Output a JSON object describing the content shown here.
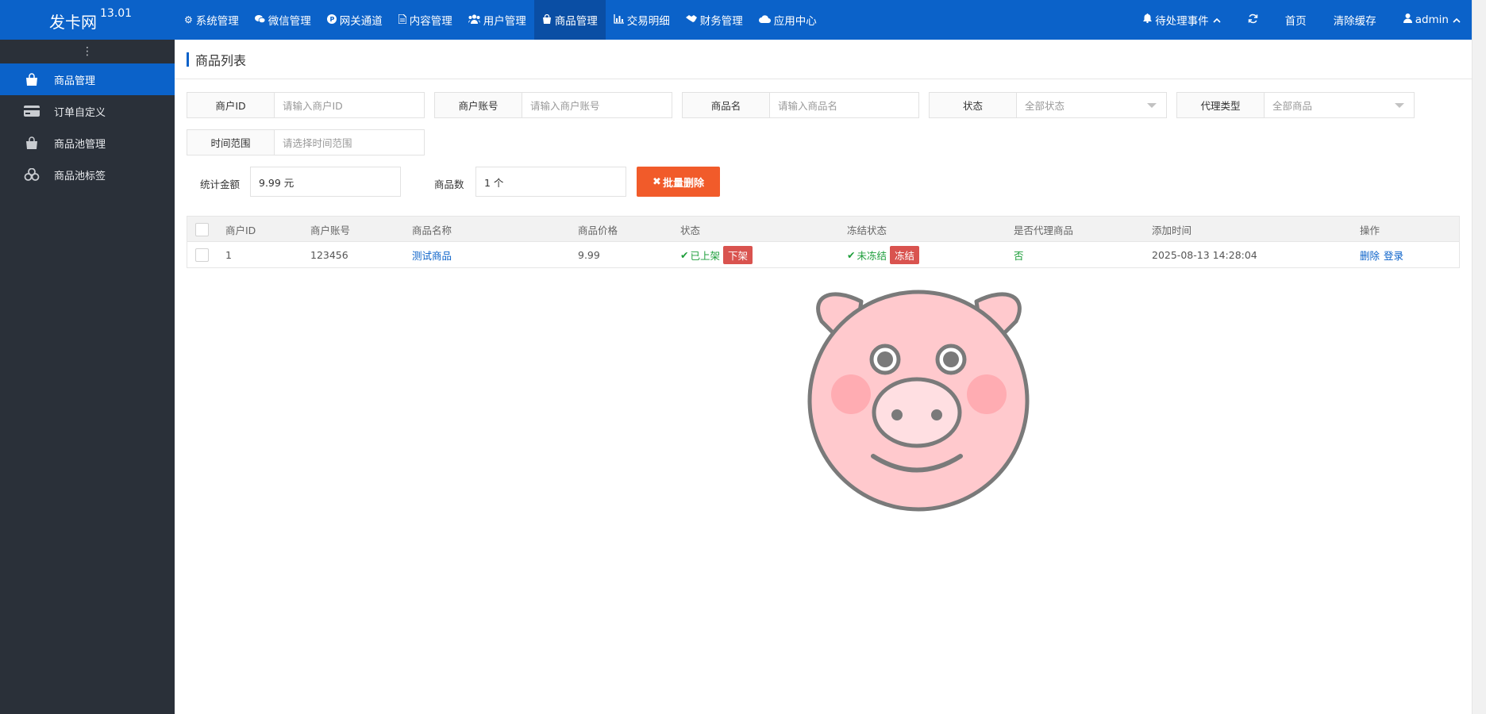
{
  "app": {
    "title": "发卡网",
    "version": "13.01"
  },
  "topnav": [
    {
      "label": "系统管理",
      "icon": "gear-icon"
    },
    {
      "label": "微信管理",
      "icon": "wechat-icon"
    },
    {
      "label": "网关通道",
      "icon": "paypal-icon"
    },
    {
      "label": "内容管理",
      "icon": "file-icon"
    },
    {
      "label": "用户管理",
      "icon": "users-icon"
    },
    {
      "label": "商品管理",
      "icon": "shopping-bag-icon",
      "active": true
    },
    {
      "label": "交易明细",
      "icon": "bar-chart-icon"
    },
    {
      "label": "财务管理",
      "icon": "handshake-icon"
    },
    {
      "label": "应用中心",
      "icon": "cloud-icon"
    }
  ],
  "topright": {
    "pending": "待处理事件",
    "home": "首页",
    "clear_cache": "清除缓存",
    "user": "admin"
  },
  "sidebar": {
    "items": [
      {
        "label": "商品管理",
        "icon": "shopping-bag-icon",
        "active": true
      },
      {
        "label": "订单自定义",
        "icon": "credit-card-icon"
      },
      {
        "label": "商品池管理",
        "icon": "shopping-bag-icon"
      },
      {
        "label": "商品池标签",
        "icon": "cubes-icon"
      }
    ]
  },
  "page": {
    "title": "商品列表"
  },
  "filters": {
    "merchant_id": {
      "label": "商户ID",
      "placeholder": "请输入商户ID"
    },
    "merchant_account": {
      "label": "商户账号",
      "placeholder": "请输入商户账号"
    },
    "product_name": {
      "label": "商品名",
      "placeholder": "请输入商品名"
    },
    "status": {
      "label": "状态",
      "value": "全部状态"
    },
    "agent_type": {
      "label": "代理类型",
      "value": "全部商品"
    },
    "time_range": {
      "label": "时间范围",
      "placeholder": "请选择时间范围"
    }
  },
  "stats": {
    "amount_label": "统计金额",
    "amount_value": "9.99 元",
    "count_label": "商品数",
    "count_value": "1 个",
    "batch_delete": "批量删除"
  },
  "table": {
    "headers": [
      "商户ID",
      "商户账号",
      "商品名称",
      "商品价格",
      "状态",
      "冻结状态",
      "是否代理商品",
      "添加时间",
      "操作"
    ],
    "rows": [
      {
        "merchant_id": "1",
        "merchant_account": "123456",
        "product_name": "测试商品",
        "price": "9.99",
        "status": "已上架",
        "status_action": "下架",
        "freeze_status": "未冻结",
        "freeze_action": "冻结",
        "is_agent": "否",
        "added_at": "2025-08-13 14:28:04",
        "action_delete": "删除",
        "action_login": "登录"
      }
    ]
  },
  "colors": {
    "primary": "#0b62c9",
    "sidebar": "#2a3039",
    "danger": "#d9534f",
    "orange": "#f15b2a",
    "success": "#1e9e3b"
  }
}
